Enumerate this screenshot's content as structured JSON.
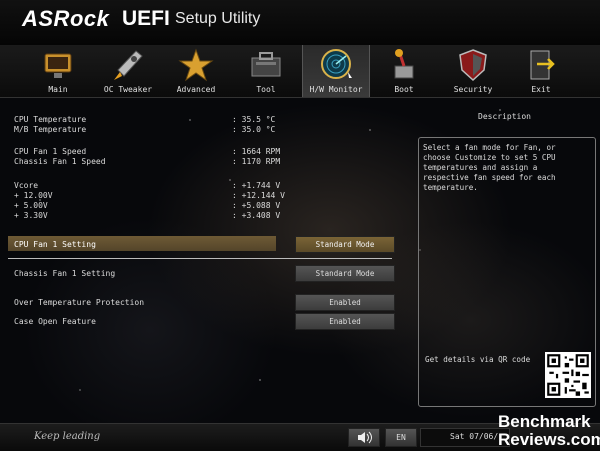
{
  "header": {
    "brand": "ASRock",
    "uefi": "UEFI",
    "setup": "Setup Utility"
  },
  "nav": {
    "items": [
      {
        "label": "Main",
        "icon": "main-monitor-icon"
      },
      {
        "label": "OC Tweaker",
        "icon": "rocket-icon"
      },
      {
        "label": "Advanced",
        "icon": "star-icon"
      },
      {
        "label": "Tool",
        "icon": "toolbox-icon"
      },
      {
        "label": "H/W Monitor",
        "icon": "radar-icon"
      },
      {
        "label": "Boot",
        "icon": "boot-joystick-icon"
      },
      {
        "label": "Security",
        "icon": "shield-icon"
      },
      {
        "label": "Exit",
        "icon": "exit-door-icon"
      }
    ],
    "active": "H/W Monitor"
  },
  "monitor": {
    "cpu_temp": {
      "label": "CPU Temperature",
      "value": ": 35.5 °C"
    },
    "mb_temp": {
      "label": "M/B Temperature",
      "value": ": 35.0 °C"
    },
    "cpu_fan": {
      "label": "CPU Fan 1 Speed",
      "value": ": 1664 RPM"
    },
    "chassis_fan": {
      "label": "Chassis Fan 1 Speed",
      "value": ": 1170 RPM"
    },
    "vcore": {
      "label": "Vcore",
      "value": ": +1.744 V"
    },
    "v12": {
      "label": "+ 12.00V",
      "value": ": +12.144 V"
    },
    "v5": {
      "label": "+ 5.00V",
      "value": ": +5.088 V"
    },
    "v33": {
      "label": "+ 3.30V",
      "value": ": +3.408 V"
    }
  },
  "settings": {
    "cpu_fan_setting": {
      "label": "CPU Fan 1 Setting",
      "value": "Standard Mode"
    },
    "chassis_fan_setting": {
      "label": "Chassis Fan 1 Setting",
      "value": "Standard Mode"
    },
    "over_temp": {
      "label": "Over Temperature Protection",
      "value": "Enabled"
    },
    "case_open": {
      "label": "Case Open Feature",
      "value": "Enabled"
    }
  },
  "description": {
    "title": "Description",
    "text": "Select a fan mode for Fan, or\nchoose Customize to set 5 CPU\ntemperatures and assign a\nrespective fan speed for each\ntemperature.",
    "qr_label": "Get details via QR code"
  },
  "footer": {
    "slogan": "Keep leading",
    "language": "EN",
    "date": "Sat 07/06/"
  },
  "watermark": {
    "line1": "Benchmark",
    "line2": "Reviews.com"
  },
  "colors": {
    "highlight": "#6e5a35",
    "accent_gold": "#d9b24a"
  }
}
